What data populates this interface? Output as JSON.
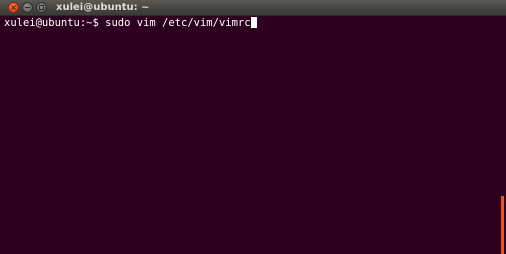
{
  "window": {
    "title": "xulei@ubuntu: ~",
    "controls": {
      "close": "close",
      "minimize": "minimize",
      "maximize": "maximize"
    }
  },
  "terminal": {
    "prompt": "xulei@ubuntu:~$ ",
    "command": "sudo vim /etc/vim/vimrc"
  },
  "colors": {
    "background": "#2c001e",
    "text": "#ffffff",
    "titlebar": "#3c3b37",
    "close_button": "#e4521f"
  },
  "icons": {
    "close": "close-icon",
    "minimize": "minimize-icon",
    "maximize": "maximize-icon"
  }
}
